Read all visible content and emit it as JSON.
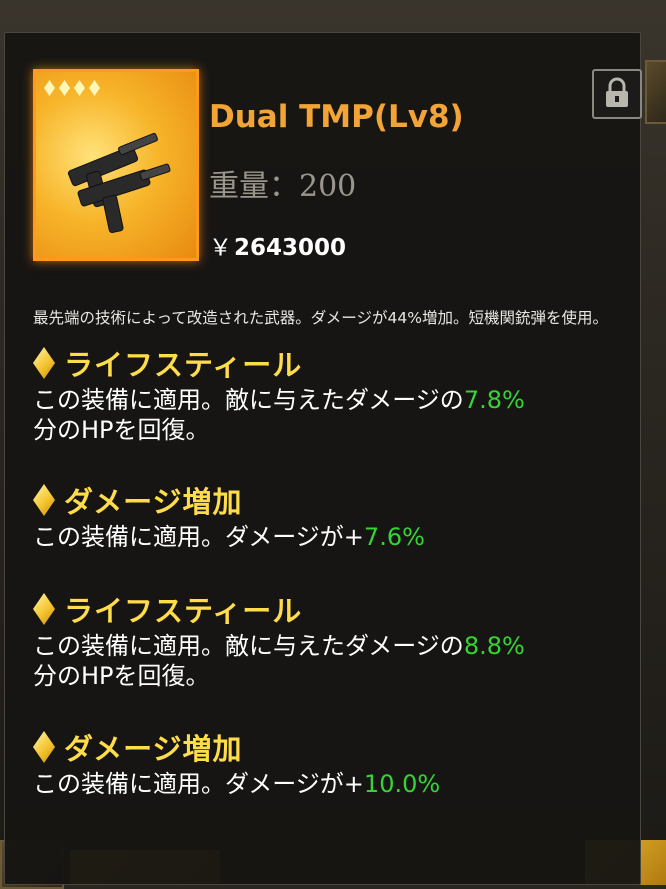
{
  "item": {
    "title": "Dual TMP(Lv8)",
    "weight": "重量：200",
    "price_symbol": "￥",
    "price": "2643000",
    "rarity_stars": 4,
    "icon": "submachine-gun-icon"
  },
  "description": "最先端の技術によって改造された武器。ダメージが44%増加。短機関銃弾を使用。",
  "skills": [
    {
      "name": "ライフスティール",
      "pre": "この装備に適用。敵に与えたダメージの",
      "value": "7.8%",
      "post": "分のHPを回復。"
    },
    {
      "name": "ダメージ増加",
      "pre": "この装備に適用。ダメージが+",
      "value": "7.6%",
      "post": ""
    },
    {
      "name": "ライフスティール",
      "pre": "この装備に適用。敵に与えたダメージの",
      "value": "8.8%",
      "post": "分のHPを回復。"
    },
    {
      "name": "ダメージ増加",
      "pre": "この装備に適用。ダメージが+",
      "value": "10.0%",
      "post": ""
    }
  ],
  "colors": {
    "title": "#f3a436",
    "skill_name": "#ffdd4a",
    "value": "#35d435"
  }
}
